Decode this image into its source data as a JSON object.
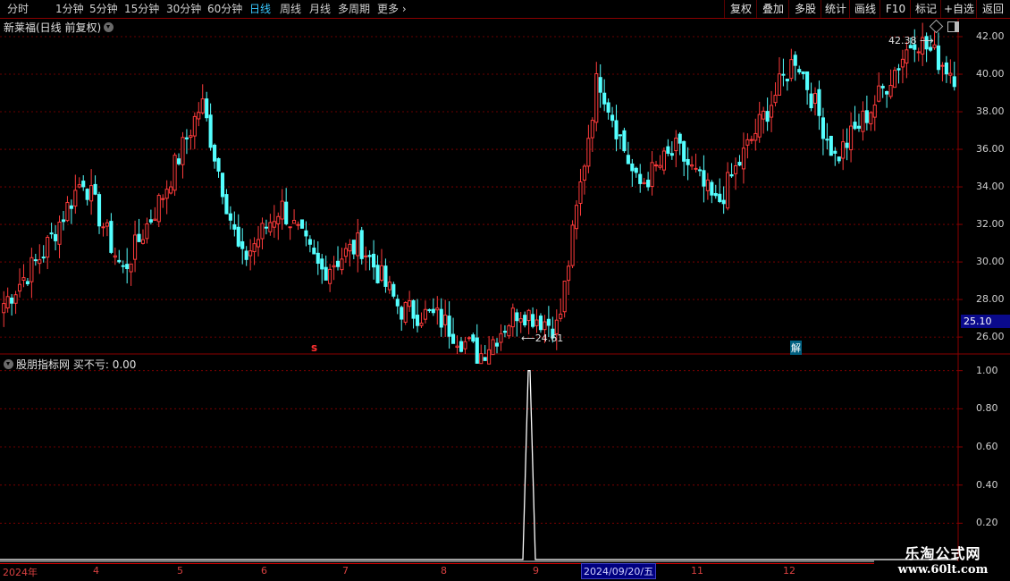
{
  "toolbar": {
    "periods": [
      "分时",
      "1分钟",
      "5分钟",
      "15分钟",
      "30分钟",
      "60分钟",
      "日线",
      "周线",
      "月线",
      "多周期",
      "更多"
    ],
    "active_period": "日线",
    "right_buttons": [
      "复权",
      "叠加",
      "多股",
      "统计",
      "画线",
      "F10",
      "标记",
      "+自选",
      "返回"
    ]
  },
  "main_chart": {
    "title": "新莱福(日线 前复权)",
    "y_ticks": [
      "42.00",
      "40.00",
      "38.00",
      "36.00",
      "34.00",
      "32.00",
      "30.00",
      "28.00",
      "26.00"
    ],
    "current_price": "25.10",
    "high_annotation": "42.38",
    "low_annotation": "24.61",
    "signal_s": "s",
    "signal_jie": "解"
  },
  "indicator": {
    "title": "股朋指标网",
    "label": "买不亏: 0.00",
    "y_ticks": [
      "1.00",
      "0.80",
      "0.60",
      "0.40",
      "0.20"
    ]
  },
  "x_axis": {
    "labels": [
      "2024年",
      "4",
      "5",
      "6",
      "7",
      "8",
      "9",
      "2024/09/20/五",
      "11",
      "12"
    ],
    "selected": "2024/09/20/五"
  },
  "watermark": {
    "line1": "乐淘公式网",
    "line2": "www.60lt.com"
  },
  "colors": {
    "up": "#ff3b3b",
    "down": "#54ffff",
    "grid": "#8b0000",
    "active_tab": "#38c8ff"
  },
  "chart_data": {
    "type": "candlestick",
    "title": "新莱福(日线 前复权)",
    "ylim": [
      25.1,
      43
    ],
    "range_high": 42.38,
    "range_low": 24.61,
    "segments": [
      {
        "x": "2024年",
        "price": 27.8
      },
      {
        "x": "4",
        "price": 30.5
      },
      {
        "x": "",
        "price": 34.5
      },
      {
        "x": "",
        "price": 29.5
      },
      {
        "x": "5",
        "price": 33.5
      },
      {
        "x": "",
        "price": 38.5
      },
      {
        "x": "6",
        "price": 30.0
      },
      {
        "x": "",
        "price": 33.0
      },
      {
        "x": "7",
        "price": 29.5
      },
      {
        "x": "",
        "price": 31.0
      },
      {
        "x": "",
        "price": 27.5
      },
      {
        "x": "8",
        "price": 27.0
      },
      {
        "x": "",
        "price": 25.0
      },
      {
        "x": "9",
        "price": 27.5
      },
      {
        "x": "2024/09/20/五",
        "price": 26.5
      },
      {
        "x": "",
        "price": 40.0
      },
      {
        "x": "",
        "price": 34.0
      },
      {
        "x": "11",
        "price": 36.0
      },
      {
        "x": "",
        "price": 33.0
      },
      {
        "x": "12",
        "price": 37.0
      },
      {
        "x": "",
        "price": 41.0
      },
      {
        "x": "",
        "price": 35.5
      },
      {
        "x": "",
        "price": 38.5
      },
      {
        "x": "",
        "price": 42.0
      },
      {
        "x": "",
        "price": 40.0
      }
    ],
    "indicator_series": {
      "name": "买不亏",
      "ylim": [
        0,
        1.05
      ],
      "spike_value": 1.0
    }
  }
}
